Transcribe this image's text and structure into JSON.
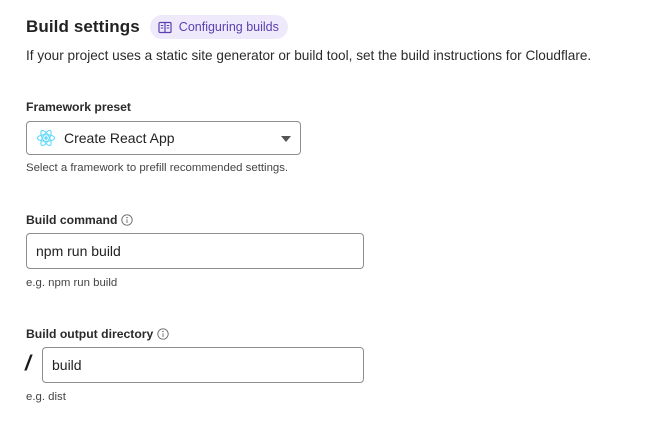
{
  "section": {
    "title": "Build settings",
    "doc_link_label": "Configuring builds",
    "intro": "If your project uses a static site generator or build tool, set the build instructions for Cloudflare."
  },
  "framework_preset": {
    "label": "Framework preset",
    "selected": "Create React App",
    "selected_icon": "react-icon",
    "helper": "Select a framework to prefill recommended settings."
  },
  "build_command": {
    "label": "Build command",
    "value": "npm run build",
    "helper": "e.g. npm run build"
  },
  "build_output": {
    "label": "Build output directory",
    "prefix": "/",
    "value": "build",
    "helper": "e.g. dist"
  },
  "colors": {
    "accent_purple": "#5b3fb0",
    "pill_bg": "#eee9fb",
    "react_blue": "#61dafb",
    "input_border": "#8e8e8e"
  }
}
